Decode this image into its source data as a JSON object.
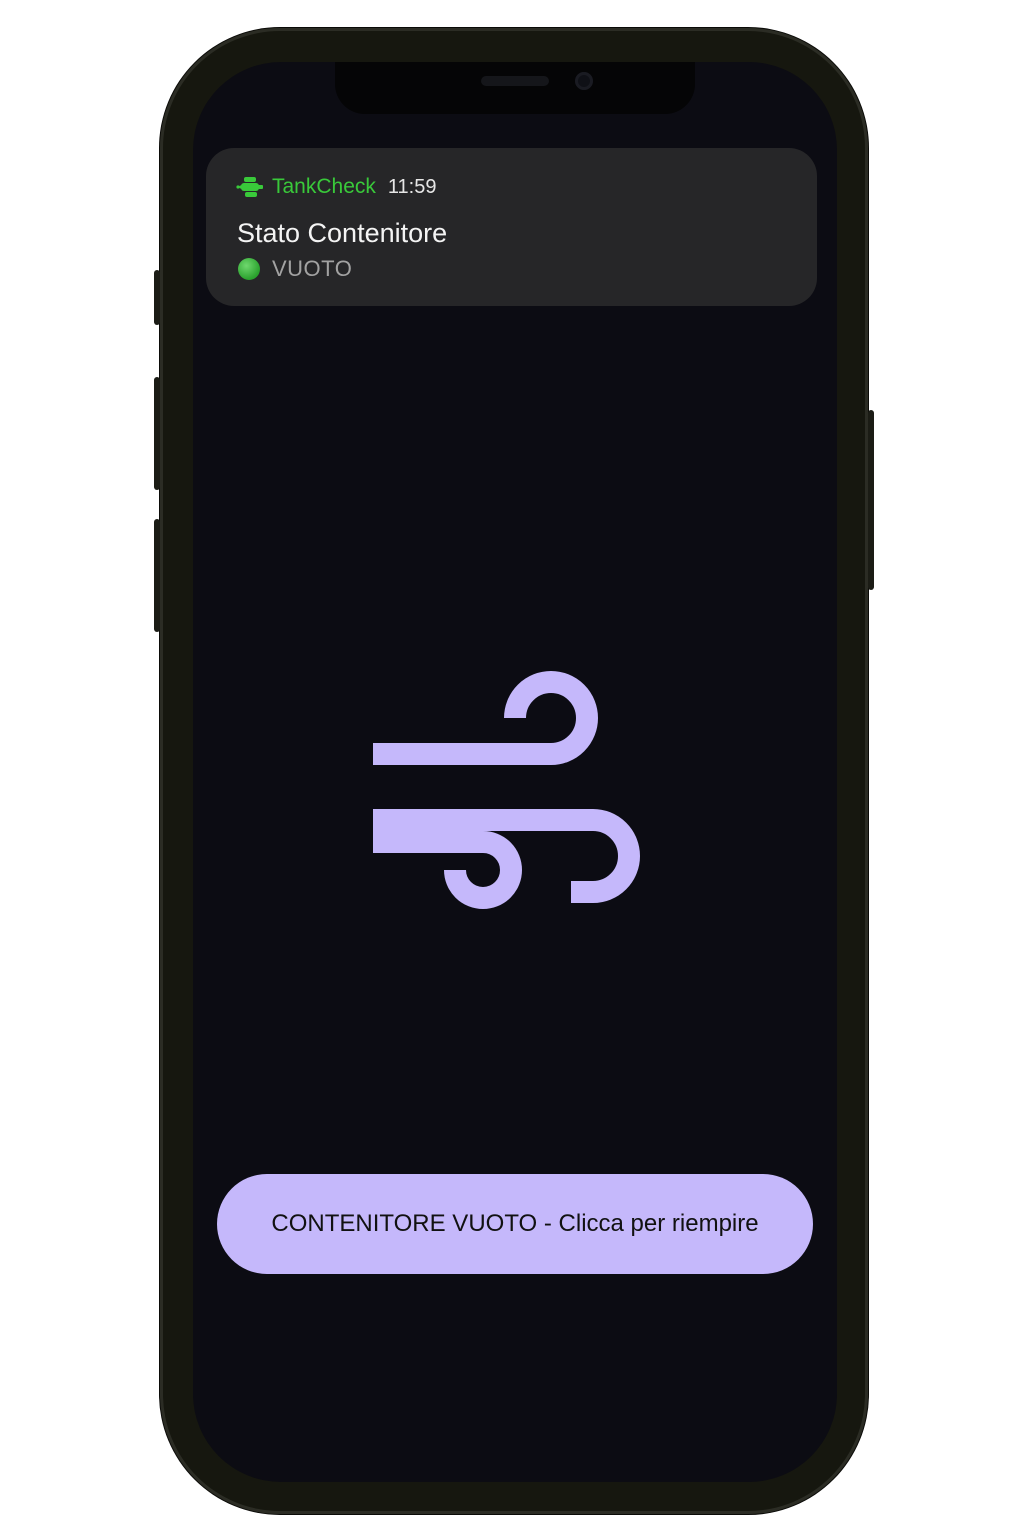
{
  "notification": {
    "app_name": "TankCheck",
    "time": "11:59",
    "title": "Stato Contenitore",
    "status": "VUOTO",
    "status_color": "#39c93a",
    "app_icon": "tank-icon"
  },
  "main": {
    "icon": "wind-icon",
    "accent_color": "#c5b8fb"
  },
  "action_button": {
    "label": "CONTENITORE VUOTO - Clicca per riempire"
  }
}
